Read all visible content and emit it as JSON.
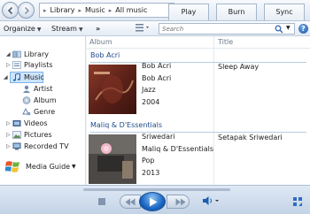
{
  "nav": {
    "breadcrumb": [
      "Library",
      "Music",
      "All music"
    ]
  },
  "tabs": [
    {
      "label": "Play"
    },
    {
      "label": "Burn"
    },
    {
      "label": "Sync"
    }
  ],
  "toolbar": {
    "organize_label": "Organize",
    "stream_label": "Stream",
    "more_label": "»",
    "search_placeholder": "Search"
  },
  "sidebar": {
    "items": [
      {
        "label": "Library",
        "icon": "library-icon"
      },
      {
        "label": "Playlists",
        "icon": "playlists-icon"
      },
      {
        "label": "Music",
        "icon": "music-note-icon",
        "selected": true
      },
      {
        "label": "Artist",
        "icon": "artist-icon"
      },
      {
        "label": "Album",
        "icon": "album-icon"
      },
      {
        "label": "Genre",
        "icon": "genre-icon"
      },
      {
        "label": "Videos",
        "icon": "videos-icon"
      },
      {
        "label": "Pictures",
        "icon": "pictures-icon"
      },
      {
        "label": "Recorded TV",
        "icon": "recorded-tv-icon"
      }
    ],
    "media_guide_label": "Media Guide"
  },
  "columns": {
    "album": "Album",
    "title": "Title"
  },
  "groups": [
    {
      "header": "Bob Acri",
      "album_lines": [
        "Bob Acri",
        "Bob Acri",
        "Jazz",
        "2004"
      ],
      "tracks": [
        "Sleep Away"
      ]
    },
    {
      "header": "Maliq & D'Essentials",
      "album_lines": [
        "Sriwedari",
        "Maliq & D'Essentials",
        "Pop",
        "2013"
      ],
      "tracks": [
        "Setapak Sriwedari"
      ]
    }
  ],
  "colors": {
    "accent": "#1f4a8a",
    "selection": "#cde4fb",
    "play_button": "#1b67c4"
  }
}
